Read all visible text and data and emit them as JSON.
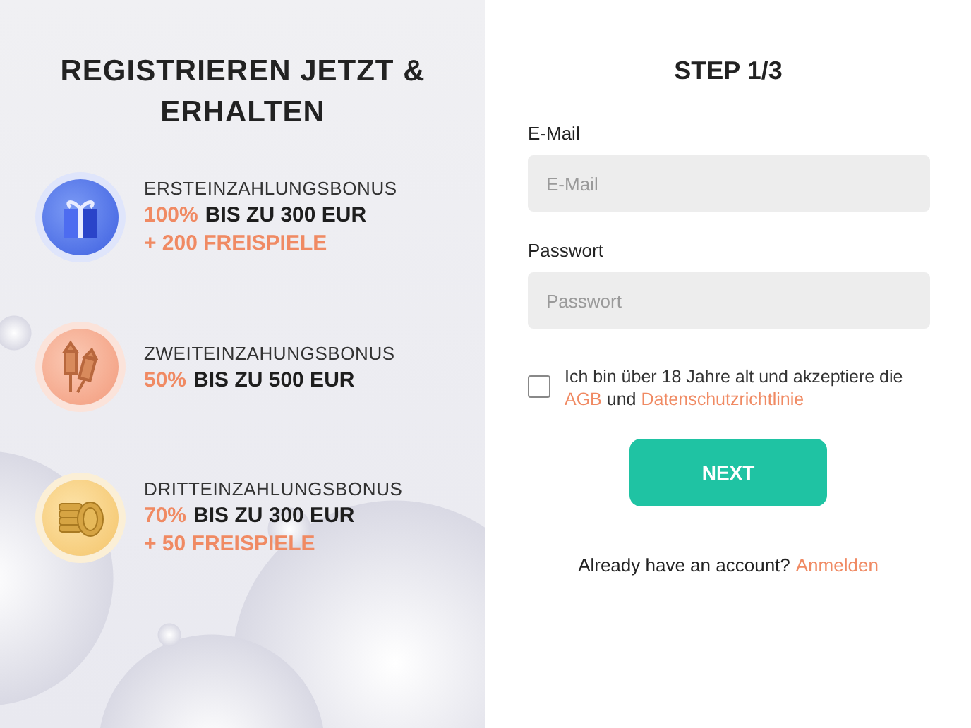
{
  "promo": {
    "title": "REGISTRIEREN JETZT & ERHALTEN",
    "bonuses": [
      {
        "kind": "gift",
        "label": "ERSTEINZAHLUNGSBONUS",
        "percent": "100%",
        "amount": "BIS ZU 300 EUR",
        "extra": "+ 200 FREISPIELE"
      },
      {
        "kind": "rockets",
        "label": "ZWEITEINZAHUNGSBONUS",
        "percent": "50%",
        "amount": "BIS ZU 500 EUR"
      },
      {
        "kind": "coins",
        "label": "DRITTEINZAHLUNGSBONUS",
        "percent": "70%",
        "amount": "BIS ZU 300 EUR",
        "extra": "+ 50 FREISPIELE"
      }
    ]
  },
  "form": {
    "step": "STEP 1/3",
    "fields": [
      {
        "label": "E-Mail",
        "placeholder": "E-Mail"
      },
      {
        "label": "Passwort",
        "placeholder": "Passwort"
      }
    ],
    "terms": {
      "checked": false,
      "text": "Ich bin über 18 Jahre alt und akzeptiere die",
      "link_1": "AGB",
      "joiner": "und",
      "link_2": "Datenschutzrichtlinie"
    },
    "next_button": "NEXT",
    "login": {
      "prompt": "Already have an account?",
      "link": "Anmelden"
    }
  }
}
